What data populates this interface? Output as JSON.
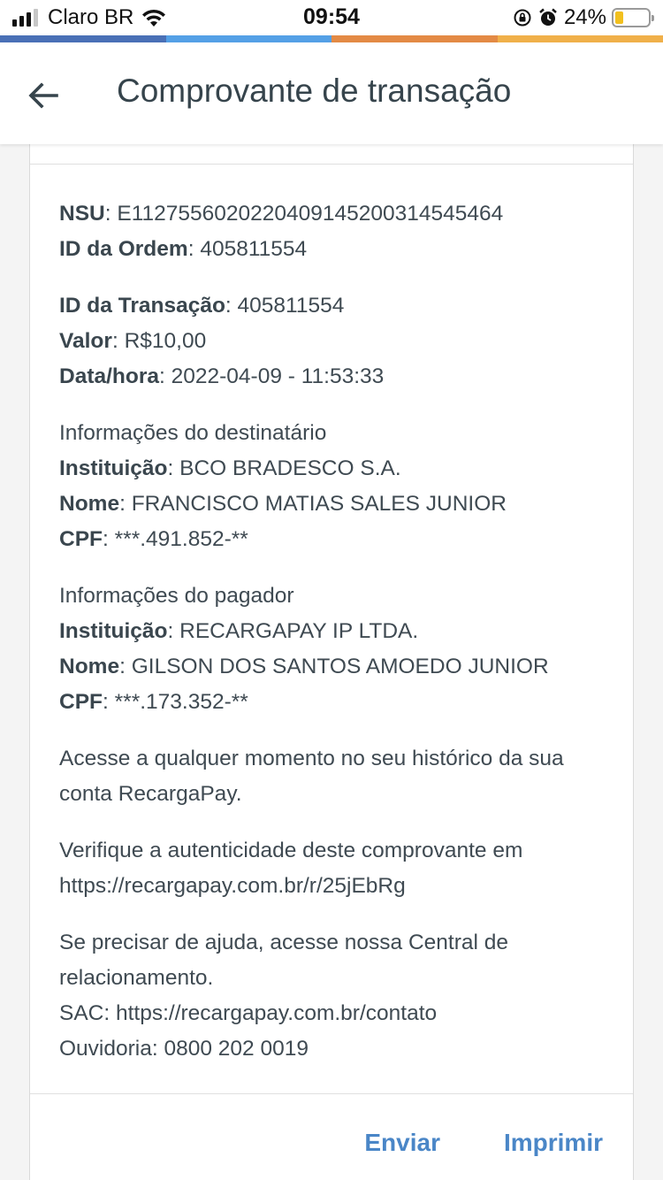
{
  "status_bar": {
    "carrier": "Claro BR",
    "time": "09:54",
    "battery": "24%",
    "battery_level": 0.24,
    "signal_bars": 3,
    "signal_total": 4,
    "icons": [
      "signal-icon",
      "wifi-icon",
      "rotation-lock-icon",
      "alarm-icon",
      "battery-icon"
    ]
  },
  "colors": {
    "strip": [
      "#4a70b6",
      "#54a0e6",
      "#e38a45",
      "#f0b04a"
    ],
    "accent": "#4a86c7"
  },
  "header": {
    "title": "Comprovante de transação",
    "back_icon": "arrow-left-icon"
  },
  "receipt": {
    "nsu_label": "NSU",
    "nsu": "E11275560202204091452003145454 64",
    "order_label": "ID da Ordem",
    "order_id": "405811554",
    "transaction_label": "ID da Transação",
    "transaction_id": "405811554",
    "value_label": "Valor",
    "value": "R$10,00",
    "datetime_label": "Data/hora",
    "datetime": "2022-04-09 - 11:53:33",
    "recipient_heading": "Informações do destinatário",
    "recipient_institution_label": "Instituição",
    "recipient_institution": "BCO BRADESCO S.A.",
    "recipient_name_label": "Nome",
    "recipient_name": "FRANCISCO MATIAS SALES JUNIOR",
    "recipient_cpf_label": "CPF",
    "recipient_cpf": "***.491.852-**",
    "payer_heading": "Informações do pagador",
    "payer_institution_label": "Instituição",
    "payer_institution": "RECARGAPAY IP LTDA.",
    "payer_name_label": "Nome",
    "payer_name": "GILSON DOS SANTOS AMOEDO JUNIOR",
    "payer_cpf_label": "CPF",
    "payer_cpf": "***.173.352-**",
    "history_text": "Acesse a qualquer momento no seu histórico da sua conta RecargaPay.",
    "verify_text": "Verifique a autenticidade deste comprovante em",
    "verify_url": "https://recargapay.com.br/r/25jEbRg",
    "help_text": "Se precisar de ajuda, acesse nossa Central de relacionamento.",
    "sac": "SAC: https://recargapay.com.br/contato",
    "ombudsman": "Ouvidoria: 0800 202 0019"
  },
  "actions": {
    "send": "Enviar",
    "print": "Imprimir"
  }
}
